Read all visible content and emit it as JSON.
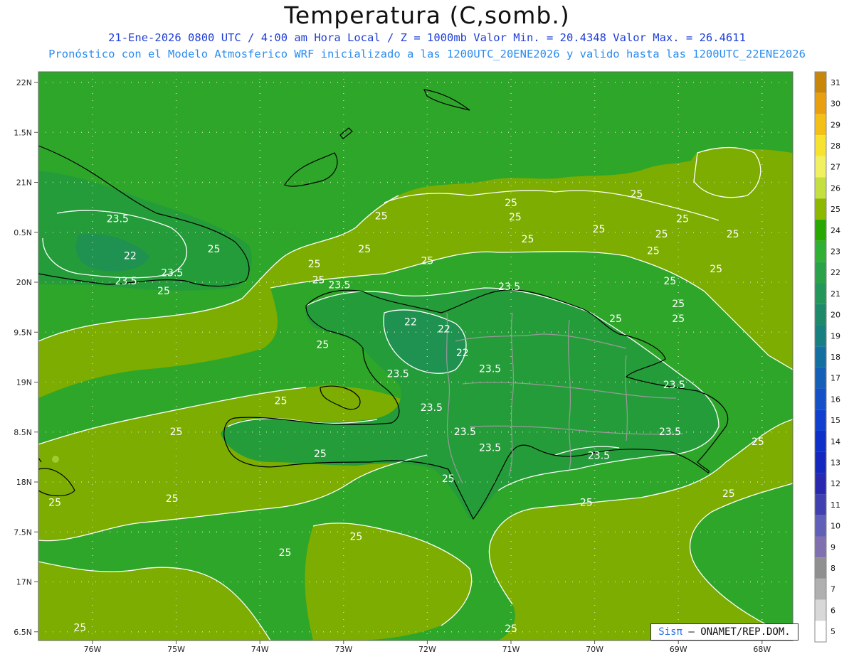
{
  "header": {
    "title": "Temperatura (C,somb.)",
    "line1": "21-Ene-2026  0800 UTC / 4:00 am Hora Local / Z = 1000mb   Valor Min. = 20.4348  Valor Max. = 26.4611",
    "line2": "Pronóstico con el Modelo Atmosferico WRF inicializado a las 1200UTC_20ENE2026 y valido hasta las  1200UTC_22ENE2026"
  },
  "axes": {
    "lat_labels": [
      "22N",
      "1.5N",
      "21N",
      "0.5N",
      "20N",
      "9.5N",
      "19N",
      "8.5N",
      "18N",
      "7.5N",
      "17N",
      "6.5N"
    ],
    "lon_labels": [
      "76W",
      "75W",
      "74W",
      "73W",
      "72W",
      "71W",
      "70W",
      "69W",
      "68W"
    ]
  },
  "colorbar": {
    "levels": [
      "31",
      "30",
      "29",
      "28",
      "27",
      "26",
      "25",
      "24",
      "23",
      "22",
      "21",
      "20",
      "19",
      "18",
      "17",
      "16",
      "15",
      "14",
      "13",
      "12",
      "11",
      "10",
      "9",
      "8",
      "7",
      "6",
      "5"
    ],
    "colors": [
      "#c8860a",
      "#e8a010",
      "#f4c018",
      "#f8e230",
      "#f0f060",
      "#c4e040",
      "#8cb800",
      "#28a800",
      "#30b034",
      "#2aa24a",
      "#24965a",
      "#1e8a6a",
      "#188080",
      "#1470a0",
      "#1460b8",
      "#1450c8",
      "#1040d0",
      "#0c30c8",
      "#1428c0",
      "#2828b0",
      "#4040b0",
      "#6060b8",
      "#8070b0",
      "#909090",
      "#b0b0b0",
      "#d8d8d8",
      "#ffffff"
    ]
  },
  "contour_labels": [
    {
      "text": "23.5",
      "lon": -75.7,
      "lat": 20.6
    },
    {
      "text": "22",
      "lon": -75.55,
      "lat": 20.23
    },
    {
      "text": "23.5",
      "lon": -75.05,
      "lat": 20.06
    },
    {
      "text": "23.5",
      "lon": -75.6,
      "lat": 19.98
    },
    {
      "text": "25",
      "lon": -74.55,
      "lat": 20.3
    },
    {
      "text": "25",
      "lon": -75.15,
      "lat": 19.88
    },
    {
      "text": "25",
      "lon": -73.35,
      "lat": 20.15
    },
    {
      "text": "25",
      "lon": -73.3,
      "lat": 19.99
    },
    {
      "text": "25",
      "lon": -72.55,
      "lat": 20.63
    },
    {
      "text": "25",
      "lon": -72.75,
      "lat": 20.3
    },
    {
      "text": "25",
      "lon": -72.0,
      "lat": 20.18
    },
    {
      "text": "25",
      "lon": -71.0,
      "lat": 20.76
    },
    {
      "text": "25",
      "lon": -70.95,
      "lat": 20.62
    },
    {
      "text": "25",
      "lon": -70.8,
      "lat": 20.4
    },
    {
      "text": "25",
      "lon": -69.95,
      "lat": 20.5
    },
    {
      "text": "25",
      "lon": -69.2,
      "lat": 20.45
    },
    {
      "text": "25",
      "lon": -68.95,
      "lat": 20.6
    },
    {
      "text": "25",
      "lon": -68.35,
      "lat": 20.45
    },
    {
      "text": "25",
      "lon": -68.55,
      "lat": 20.1
    },
    {
      "text": "25",
      "lon": -69.3,
      "lat": 20.28
    },
    {
      "text": "25",
      "lon": -69.5,
      "lat": 20.85
    },
    {
      "text": "25",
      "lon": -69.1,
      "lat": 19.98
    },
    {
      "text": "25",
      "lon": -69.0,
      "lat": 19.75
    },
    {
      "text": "25",
      "lon": -69.0,
      "lat": 19.6
    },
    {
      "text": "25",
      "lon": -69.75,
      "lat": 19.6
    },
    {
      "text": "23.5",
      "lon": -73.05,
      "lat": 19.94
    },
    {
      "text": "22",
      "lon": -72.2,
      "lat": 19.57
    },
    {
      "text": "22",
      "lon": -71.8,
      "lat": 19.5
    },
    {
      "text": "22",
      "lon": -71.58,
      "lat": 19.26
    },
    {
      "text": "23.5",
      "lon": -71.02,
      "lat": 19.92
    },
    {
      "text": "23.5",
      "lon": -71.25,
      "lat": 19.1
    },
    {
      "text": "25",
      "lon": -73.25,
      "lat": 19.34
    },
    {
      "text": "23.5",
      "lon": -72.35,
      "lat": 19.05
    },
    {
      "text": "25",
      "lon": -73.75,
      "lat": 18.78
    },
    {
      "text": "23.5",
      "lon": -71.95,
      "lat": 18.71
    },
    {
      "text": "23.5",
      "lon": -71.55,
      "lat": 18.47
    },
    {
      "text": "23.5",
      "lon": -71.25,
      "lat": 18.31
    },
    {
      "text": "23.5",
      "lon": -69.95,
      "lat": 18.23
    },
    {
      "text": "23.5",
      "lon": -69.05,
      "lat": 18.94
    },
    {
      "text": "23.5",
      "lon": -69.1,
      "lat": 18.47
    },
    {
      "text": "25",
      "lon": -68.05,
      "lat": 18.37
    },
    {
      "text": "25",
      "lon": -75.0,
      "lat": 18.47
    },
    {
      "text": "25",
      "lon": -73.28,
      "lat": 18.25
    },
    {
      "text": "25",
      "lon": -71.75,
      "lat": 18.0
    },
    {
      "text": "25",
      "lon": -76.45,
      "lat": 17.76
    },
    {
      "text": "25",
      "lon": -75.05,
      "lat": 17.8
    },
    {
      "text": "25",
      "lon": -70.1,
      "lat": 17.76
    },
    {
      "text": "25",
      "lon": -68.4,
      "lat": 17.85
    },
    {
      "text": "25",
      "lon": -72.85,
      "lat": 17.42
    },
    {
      "text": "25",
      "lon": -73.7,
      "lat": 17.26
    },
    {
      "text": "25",
      "lon": -76.15,
      "lat": 16.51
    },
    {
      "text": "25",
      "lon": -71.0,
      "lat": 16.5
    }
  ],
  "credit": {
    "logo": "Sisπ",
    "text": "– ONAMET/REP.DOM."
  }
}
